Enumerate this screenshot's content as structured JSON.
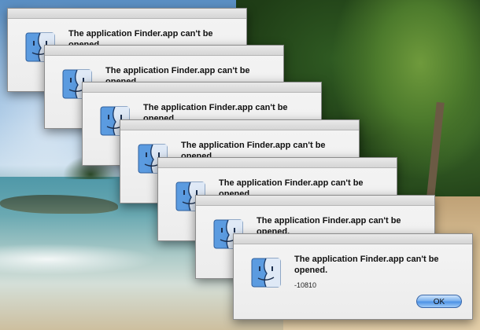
{
  "dialogs": [
    {
      "message": "The application Finder.app can't be opened.",
      "code": "",
      "ok_label": ""
    },
    {
      "message": "The application Finder.app can't be opened.",
      "code": "",
      "ok_label": ""
    },
    {
      "message": "The application Finder.app can't be opened.",
      "code": "",
      "ok_label": ""
    },
    {
      "message": "The application Finder.app can't be opened.",
      "code": "",
      "ok_label": ""
    },
    {
      "message": "The application Finder.app can't be opened.",
      "code": "",
      "ok_label": ""
    },
    {
      "message": "The application Finder.app can't be opened.",
      "code": "",
      "ok_label": ""
    },
    {
      "message": "The application Finder.app can't be opened.",
      "code": "-10810",
      "ok_label": "OK"
    }
  ],
  "icon": "finder-icon",
  "colors": {
    "ok_button": "#4e93e6",
    "dialog_bg": "#ececec",
    "finder_blue": "#5b9be0"
  }
}
